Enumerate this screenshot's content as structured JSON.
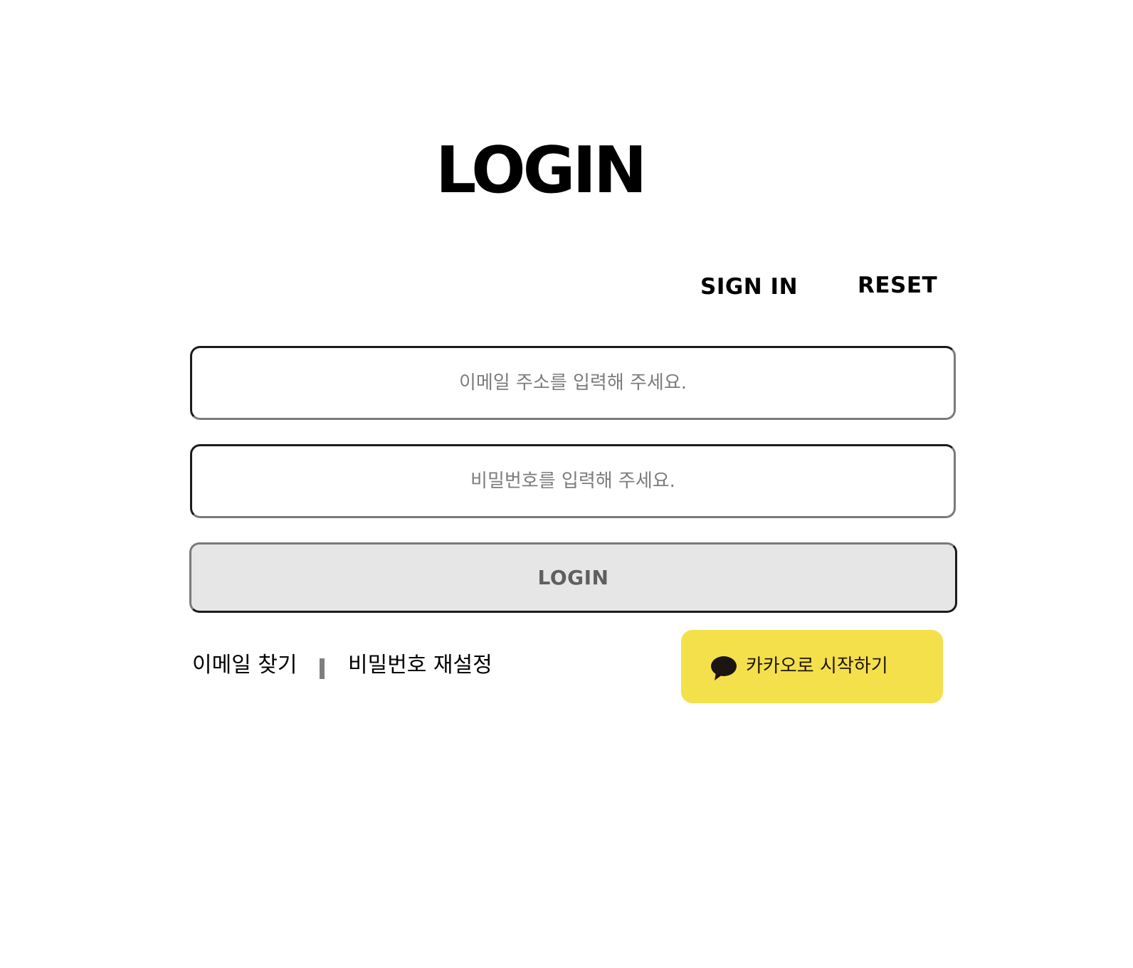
{
  "page": {
    "title": "LOGIN"
  },
  "nav": {
    "sign_in_label": "SIGN IN",
    "reset_label": "RESET"
  },
  "form": {
    "email_placeholder": "이메일 주소를 입력해 주세요.",
    "email_value": "",
    "password_placeholder": "비밀번호를 입력해 주세요.",
    "password_value": "",
    "login_button_label": "LOGIN"
  },
  "help_links": {
    "find_email_label": "이메일 찾기",
    "reset_password_label": "비밀번호 재설정"
  },
  "kakao": {
    "button_label": "카카오로 시작하기",
    "icon": "kakao-speech-bubble-icon",
    "background_color": "#f4e04a",
    "icon_color": "#1d1512"
  },
  "colors": {
    "text": "#000000",
    "placeholder": "#7c7c7c",
    "login_button_background": "#e6e6e7",
    "login_button_text": "#5f5f5f",
    "divider": "#7e7e7e"
  }
}
